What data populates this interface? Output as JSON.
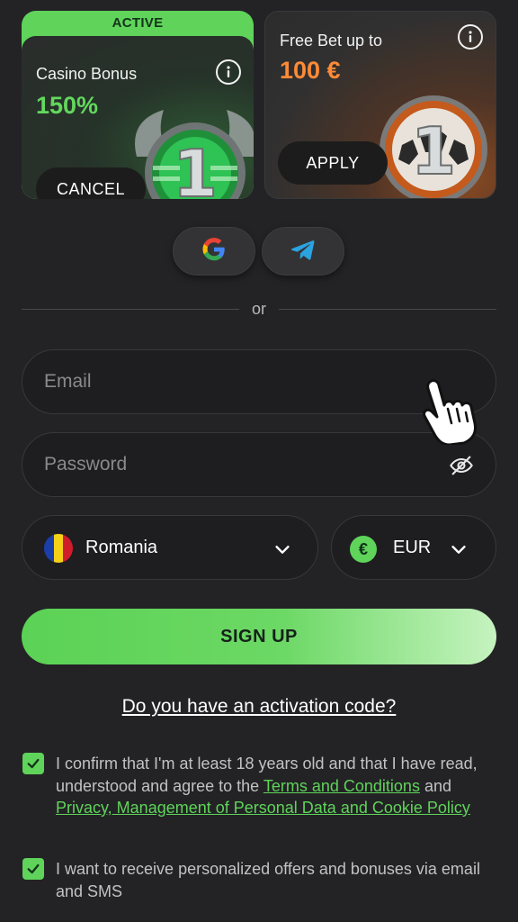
{
  "bonus_cards": {
    "casino": {
      "tag": "ACTIVE",
      "title": "Casino Bonus",
      "value": "150%",
      "button_label": "CANCEL",
      "medal_number": "1",
      "icon": "info-icon"
    },
    "freebet": {
      "title": "Free Bet up to",
      "value": "100 €",
      "button_label": "APPLY",
      "medal_number": "1",
      "icon": "info-icon"
    }
  },
  "social": {
    "providers": [
      "google-icon",
      "telegram-icon"
    ],
    "divider_text": "or"
  },
  "form": {
    "email": {
      "placeholder": "Email",
      "value": ""
    },
    "password": {
      "placeholder": "Password",
      "value": "",
      "toggle_icon": "eye-off-icon"
    },
    "country": {
      "selected": "Romania",
      "flag_icon": "romania-flag-icon"
    },
    "currency": {
      "selected": "EUR",
      "symbol": "€"
    },
    "signup_label": "SIGN UP",
    "activation_link": "Do you have an activation code?"
  },
  "consents": {
    "age": {
      "checked": true,
      "text_before": "I confirm that I'm at least 18 years old and that I have read, understood and agree to the ",
      "terms_link": "Terms and Conditions",
      "text_middle": " and ",
      "privacy_link": "Privacy, Management of Personal Data and Cookie Policy"
    },
    "marketing": {
      "checked": true,
      "text": "I want to receive personalized offers and bonuses via email and SMS"
    }
  },
  "colors": {
    "background": "#232325",
    "accent_green": "#5fd35a",
    "accent_orange": "#ff8a36",
    "field_bg": "#1e1e20"
  }
}
